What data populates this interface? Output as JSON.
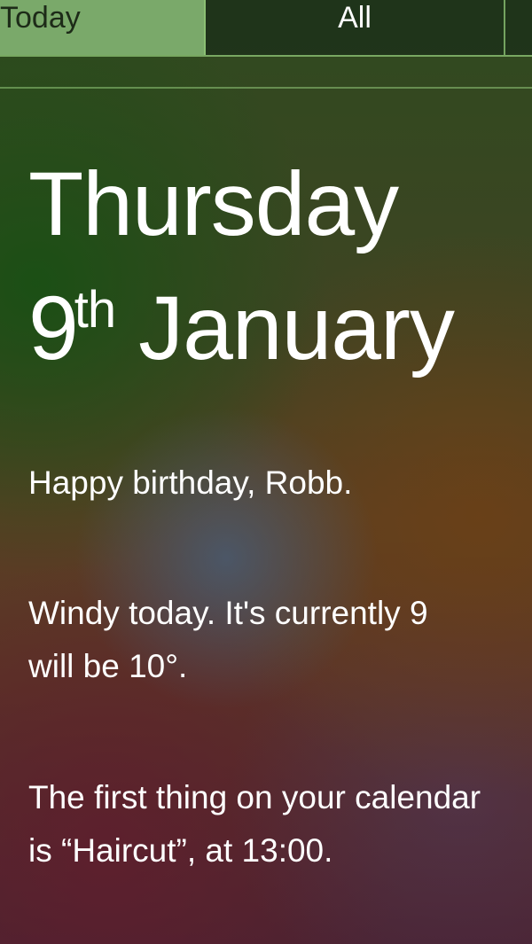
{
  "tabs": {
    "today": "Today",
    "all": "All"
  },
  "date": {
    "weekday": "Thursday",
    "day": "9",
    "suffix": "th",
    "month": "January"
  },
  "summary": {
    "birthday": "Happy birthday, Robb.",
    "weather_line1": "Windy today. It's currently 9",
    "weather_line2": "will be 10°.",
    "calendar_line1": "The first thing on your calendar",
    "calendar_line2": "is “Haircut”, at 13:00."
  }
}
